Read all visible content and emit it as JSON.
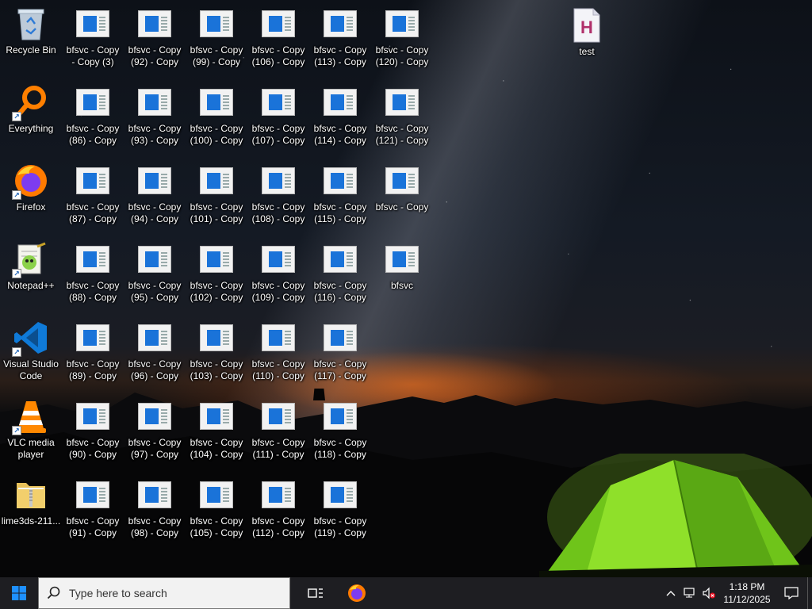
{
  "desktop": {
    "left_icons": [
      {
        "name": "recycle-bin",
        "label": "Recycle Bin",
        "icon": "recycle-bin-icon"
      },
      {
        "name": "everything",
        "label": "Everything",
        "icon": "magnifier-orange-icon"
      },
      {
        "name": "firefox",
        "label": "Firefox",
        "icon": "firefox-icon"
      },
      {
        "name": "notepadpp",
        "label": "Notepad++",
        "icon": "notepadpp-icon"
      },
      {
        "name": "vscode",
        "label": "Visual Studio\nCode",
        "icon": "vscode-icon"
      },
      {
        "name": "vlc",
        "label": "VLC media\nplayer",
        "icon": "vlc-cone-icon"
      },
      {
        "name": "lime3ds",
        "label": "lime3ds-211...",
        "icon": "zip-folder-icon"
      }
    ],
    "bfs_columns": [
      [
        "bfsvc - Copy\n- Copy (3)",
        "bfsvc - Copy\n(86) - Copy",
        "bfsvc - Copy\n(87) - Copy",
        "bfsvc - Copy\n(88) - Copy",
        "bfsvc - Copy\n(89) - Copy",
        "bfsvc - Copy\n(90) - Copy",
        "bfsvc - Copy\n(91) - Copy"
      ],
      [
        "bfsvc - Copy\n(92) - Copy",
        "bfsvc - Copy\n(93) - Copy",
        "bfsvc - Copy\n(94) - Copy",
        "bfsvc - Copy\n(95) - Copy",
        "bfsvc - Copy\n(96) - Copy",
        "bfsvc - Copy\n(97) - Copy",
        "bfsvc - Copy\n(98) - Copy"
      ],
      [
        "bfsvc - Copy\n(99) - Copy",
        "bfsvc - Copy\n(100) - Copy",
        "bfsvc - Copy\n(101) - Copy",
        "bfsvc - Copy\n(102) - Copy",
        "bfsvc - Copy\n(103) - Copy",
        "bfsvc - Copy\n(104) - Copy",
        "bfsvc - Copy\n(105) - Copy"
      ],
      [
        "bfsvc - Copy\n(106) - Copy",
        "bfsvc - Copy\n(107) - Copy",
        "bfsvc - Copy\n(108) - Copy",
        "bfsvc - Copy\n(109) - Copy",
        "bfsvc - Copy\n(110) - Copy",
        "bfsvc - Copy\n(111) - Copy",
        "bfsvc - Copy\n(112) - Copy"
      ],
      [
        "bfsvc - Copy\n(113) - Copy",
        "bfsvc - Copy\n(114) - Copy",
        "bfsvc - Copy\n(115) - Copy",
        "bfsvc - Copy\n(116) - Copy",
        "bfsvc - Copy\n(117) - Copy",
        "bfsvc - Copy\n(118) - Copy",
        "bfsvc - Copy\n(119) - Copy"
      ],
      [
        "bfsvc - Copy\n(120) - Copy",
        "bfsvc - Copy\n(121) - Copy",
        "bfsvc - Copy",
        "bfsvc"
      ]
    ],
    "test_icon": {
      "label": "test",
      "letter": "H"
    }
  },
  "taskbar": {
    "search_placeholder": "Type here to search",
    "clock_time": "1:18 PM",
    "clock_date": "11/12/2025"
  },
  "colors": {
    "taskbar_bg": "#1e1e22",
    "bfs_blue": "#1a73d9",
    "windows_blue": "#1e90ff"
  }
}
